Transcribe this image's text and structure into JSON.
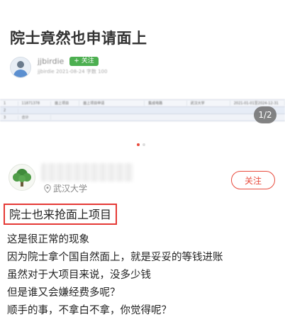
{
  "carousel": {
    "slide_title": "院士竟然也申请面上",
    "author_name": "jjbirdie",
    "follow_label": "+ 关注",
    "author_meta": "jjbirdie   2021-08-24   字数 100",
    "table_rows": [
      [
        "1",
        "11871378",
        "面上项目",
        "面上项目申请",
        "集成电路",
        "武汉大学",
        "2021-01-01至2024-12-31"
      ],
      [
        "2",
        "",
        "",
        "",
        "",
        "",
        ""
      ],
      [
        "3",
        "合计",
        "",
        "",
        "",
        "",
        ""
      ]
    ],
    "page_indicator": "1/2",
    "dot_count": 2,
    "active_dot": 0
  },
  "answer": {
    "school": "武汉大学",
    "follow_label": "关注",
    "title": "院士也来抢面上项目",
    "lines": [
      "这是很正常的现象",
      "因为院士拿个国自然面上，就是妥妥的等钱进账",
      "虽然对于大项目来说，没多少钱",
      "但是谁又会嫌经费多呢？",
      "顺手的事，不拿白不拿，你觉得呢？"
    ]
  },
  "colors": {
    "accent_red": "#e84a3c",
    "highlight_box": "#e53935",
    "follow_green": "#4caf50"
  },
  "icons": {
    "avatar_small": "default-user-avatar",
    "avatar_large": "tree-avatar",
    "location": "location-pin-icon"
  }
}
